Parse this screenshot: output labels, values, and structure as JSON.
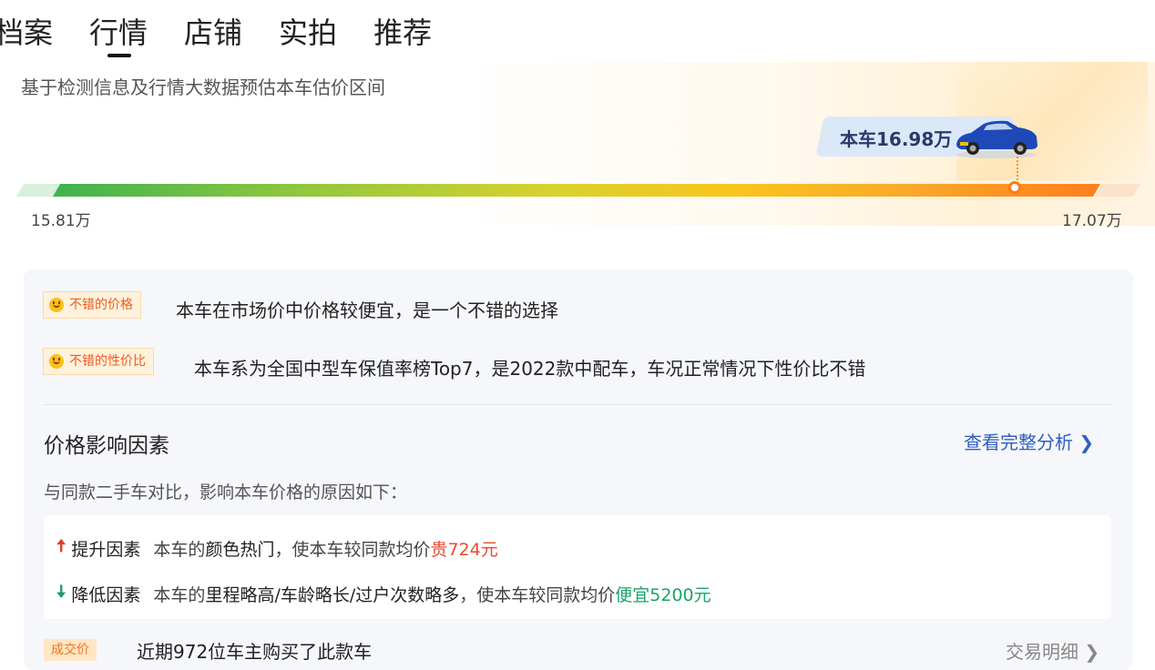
{
  "tabs": [
    {
      "label": "档案"
    },
    {
      "label": "行情",
      "active": true
    },
    {
      "label": "店铺"
    },
    {
      "label": "实拍"
    },
    {
      "label": "推荐"
    }
  ],
  "estimate": {
    "subtitle": "基于检测信息及行情大数据预估本车估价区间",
    "current_label": "本车16.98万",
    "min_label": "15.81万",
    "max_label": "17.07万",
    "current_value": 16.98,
    "min_value": 15.81,
    "max_value": 17.07
  },
  "assessments": [
    {
      "tag": "不错的价格",
      "text": "本车在市场价中价格较便宜，是一个不错的选择"
    },
    {
      "tag": "不错的性价比",
      "text": "本车系为全国中型车保值率榜Top7，是2022款中配车，车况正常情况下性价比不错"
    }
  ],
  "factors": {
    "title": "价格影响因素",
    "link": "查看完整分析 ❯",
    "desc": "与同款二手车对比，影响本车价格的原因如下：",
    "up": {
      "icon": "arrow-up-icon",
      "name": "提升因素",
      "text": "本车的",
      "reason": "颜色热门",
      "text2": "，使本车较同款均价",
      "delta": "贵724元"
    },
    "down": {
      "icon": "arrow-down-icon",
      "name": "降低因素",
      "text": "本车的",
      "reason": "里程略高/车龄略长/过户次数略多",
      "text2": "，使本车较同款均价",
      "delta": "便宜5200元"
    }
  },
  "cut_row": {
    "tag": "成交价",
    "text": "近期972位车主购买了此款车",
    "link": "交易明细 ❯"
  },
  "colors": {
    "bar_start": "#3fb34f",
    "bar_end": "#ff7f1e",
    "link": "#2f5fbf",
    "price_up": "#e94a2e",
    "price_down": "#19a468"
  }
}
